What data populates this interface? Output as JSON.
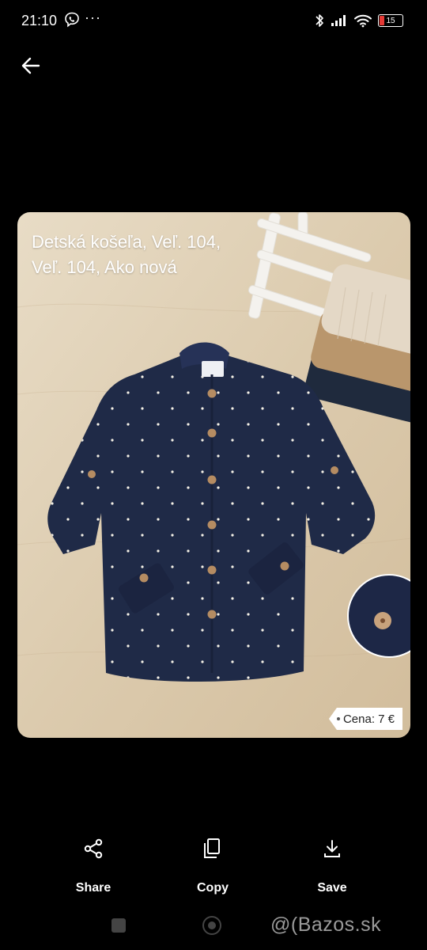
{
  "status_bar": {
    "time": "21:10",
    "more_indicator": "···",
    "battery_level": "15",
    "battery_color": "#e53935",
    "icons": [
      "viber-icon",
      "bluetooth-icon",
      "signal-icon",
      "wifi-icon",
      "battery-icon"
    ]
  },
  "toolbar": {
    "back_icon": "arrow-left-icon"
  },
  "image": {
    "title_line1": "Detská košeľa, Veľ. 104,",
    "title_line2": "Veľ. 104,  Ako nová",
    "price": "Cena: 7 €"
  },
  "actions": [
    {
      "label": "Share",
      "icon": "share-icon"
    },
    {
      "label": "Copy",
      "icon": "copy-icon"
    },
    {
      "label": "Save",
      "icon": "download-icon"
    }
  ],
  "navigation": {
    "watermark": "@(Bazos.sk"
  }
}
